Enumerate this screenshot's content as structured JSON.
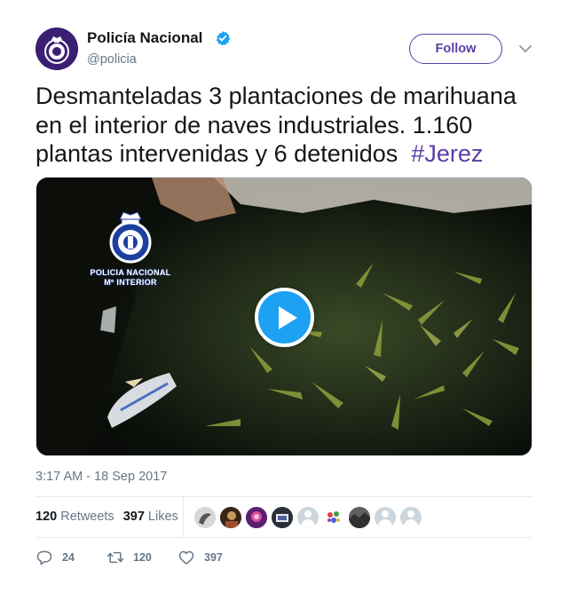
{
  "tweet": {
    "author": {
      "name": "Policía Nacional",
      "handle": "@policia",
      "verified": true,
      "avatar_icon": "police-shield-logo"
    },
    "follow_label": "Follow",
    "text": "Desmanteladas 3 plantaciones de marihuana en el interior de naves industriales. 1.160 plantas intervenidas y 6 detenidos",
    "hashtag": "#Jerez",
    "media": {
      "type": "video",
      "watermark_line1": "POLICIA NACIONAL",
      "watermark_line2": "Mº INTERIOR",
      "play_icon": "play-icon"
    },
    "timestamp": "3:17 AM - 18 Sep 2017",
    "stats": {
      "retweets_count": "120",
      "retweets_label": "Retweets",
      "likes_count": "397",
      "likes_label": "Likes"
    },
    "actions": {
      "reply_count": "24",
      "retweet_count": "120",
      "like_count": "397"
    }
  },
  "colors": {
    "accent": "#5b3ea6",
    "text": "#14171a",
    "muted": "#657786",
    "verified": "#1da1f2",
    "play": "#1da1f2"
  }
}
